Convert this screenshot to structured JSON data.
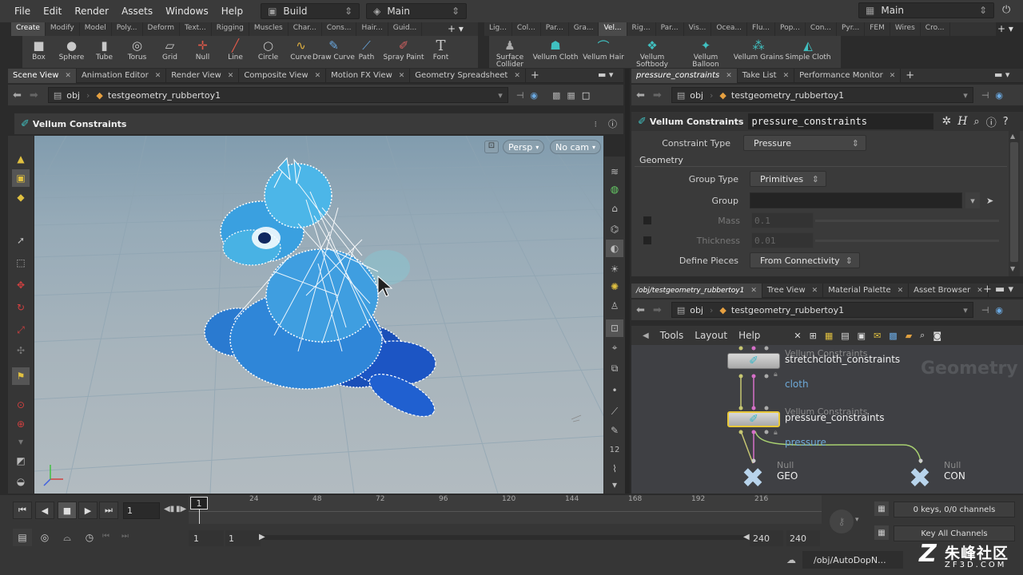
{
  "menu": [
    "File",
    "Edit",
    "Render",
    "Assets",
    "Windows",
    "Help"
  ],
  "desktop": {
    "build": "Build",
    "main": "Main",
    "main_right": "Main"
  },
  "shelf_tabs_left": [
    "Create",
    "Modify",
    "Model",
    "Poly...",
    "Deform",
    "Text...",
    "Rigging",
    "Muscles",
    "Char...",
    "Cons...",
    "Hair...",
    "Guid..."
  ],
  "shelf_tabs_right": [
    "Lig...",
    "Col...",
    "Par...",
    "Gra...",
    "Vel...",
    "Rig...",
    "Par...",
    "Vis...",
    "Ocea...",
    "Flu...",
    "Pop...",
    "Con...",
    "Pyr...",
    "FEM",
    "Wires",
    "Cro..."
  ],
  "tools_left": [
    {
      "label": "Box",
      "icon": "box-icon"
    },
    {
      "label": "Sphere",
      "icon": "sphere-icon"
    },
    {
      "label": "Tube",
      "icon": "tube-icon"
    },
    {
      "label": "Torus",
      "icon": "torus-icon"
    },
    {
      "label": "Grid",
      "icon": "grid-icon"
    },
    {
      "label": "Null",
      "icon": "null-icon"
    },
    {
      "label": "Line",
      "icon": "line-icon"
    },
    {
      "label": "Circle",
      "icon": "circle-icon"
    },
    {
      "label": "Curve",
      "icon": "curve-icon"
    },
    {
      "label": "Draw Curve",
      "icon": "draw-curve-icon"
    },
    {
      "label": "Path",
      "icon": "path-icon"
    },
    {
      "label": "Spray Paint",
      "icon": "spray-paint-icon"
    },
    {
      "label": "Font",
      "icon": "font-icon"
    }
  ],
  "tools_right": [
    {
      "label": "Surface\nCollider"
    },
    {
      "label": "Vellum Cloth"
    },
    {
      "label": "Vellum Hair"
    },
    {
      "label": "Vellum\nSoftbody"
    },
    {
      "label": "Vellum\nBalloon"
    },
    {
      "label": "Vellum Grains"
    },
    {
      "label": "Simple Cloth"
    }
  ],
  "left_tabs": [
    "Scene View",
    "Animation Editor",
    "Render View",
    "Composite View",
    "Motion FX View",
    "Geometry Spreadsheet"
  ],
  "viewport": {
    "path_obj": "obj",
    "path_geo": "testgeometry_rubbertoy1",
    "op_title": "Vellum Constraints",
    "persp": "Persp",
    "cam": "No cam"
  },
  "params": {
    "tabs": [
      "pressure_constraints",
      "Take List",
      "Performance Monitor"
    ],
    "path_obj": "obj",
    "path_geo": "testgeometry_rubbertoy1",
    "node_type": "Vellum Constraints",
    "node_name": "pressure_constraints",
    "constraint_type_label": "Constraint Type",
    "constraint_type": "Pressure",
    "geometry_heading": "Geometry",
    "group_type_label": "Group Type",
    "group_type": "Primitives",
    "group_label": "Group",
    "group_value": "",
    "mass_label": "Mass",
    "mass": "0.1",
    "thickness_label": "Thickness",
    "thickness": "0.01",
    "define_pieces_label": "Define Pieces",
    "define_pieces": "From Connectivity"
  },
  "network": {
    "tabs": [
      "/obj/testgeometry_rubbertoy1",
      "Tree View",
      "Material Palette",
      "Asset Browser"
    ],
    "path_obj": "obj",
    "path_geo": "testgeometry_rubbertoy1",
    "menu": [
      "Tools",
      "Layout",
      "Help"
    ],
    "context": "Geometry",
    "nodes": [
      {
        "type": "Vellum Constraints",
        "name": "stretchcloth_constraints",
        "label": "cloth"
      },
      {
        "type": "Vellum Constraints",
        "name": "pressure_constraints",
        "label": "pressure"
      },
      {
        "type": "Null",
        "name": "GEO"
      },
      {
        "type": "Null",
        "name": "CON"
      }
    ]
  },
  "timeline": {
    "frame": "1",
    "cursor": "1",
    "ticks": [
      "24",
      "48",
      "72",
      "96",
      "120",
      "144",
      "168",
      "192",
      "216"
    ],
    "start": "1",
    "start2": "1",
    "end": "240",
    "end2": "240",
    "keys": "0 keys, 0/0 channels",
    "key_all": "Key All Channels",
    "status": "/obj/AutoDopN..."
  },
  "watermark": {
    "brand": "朱峰社区",
    "url": "ZF3D.COM"
  }
}
